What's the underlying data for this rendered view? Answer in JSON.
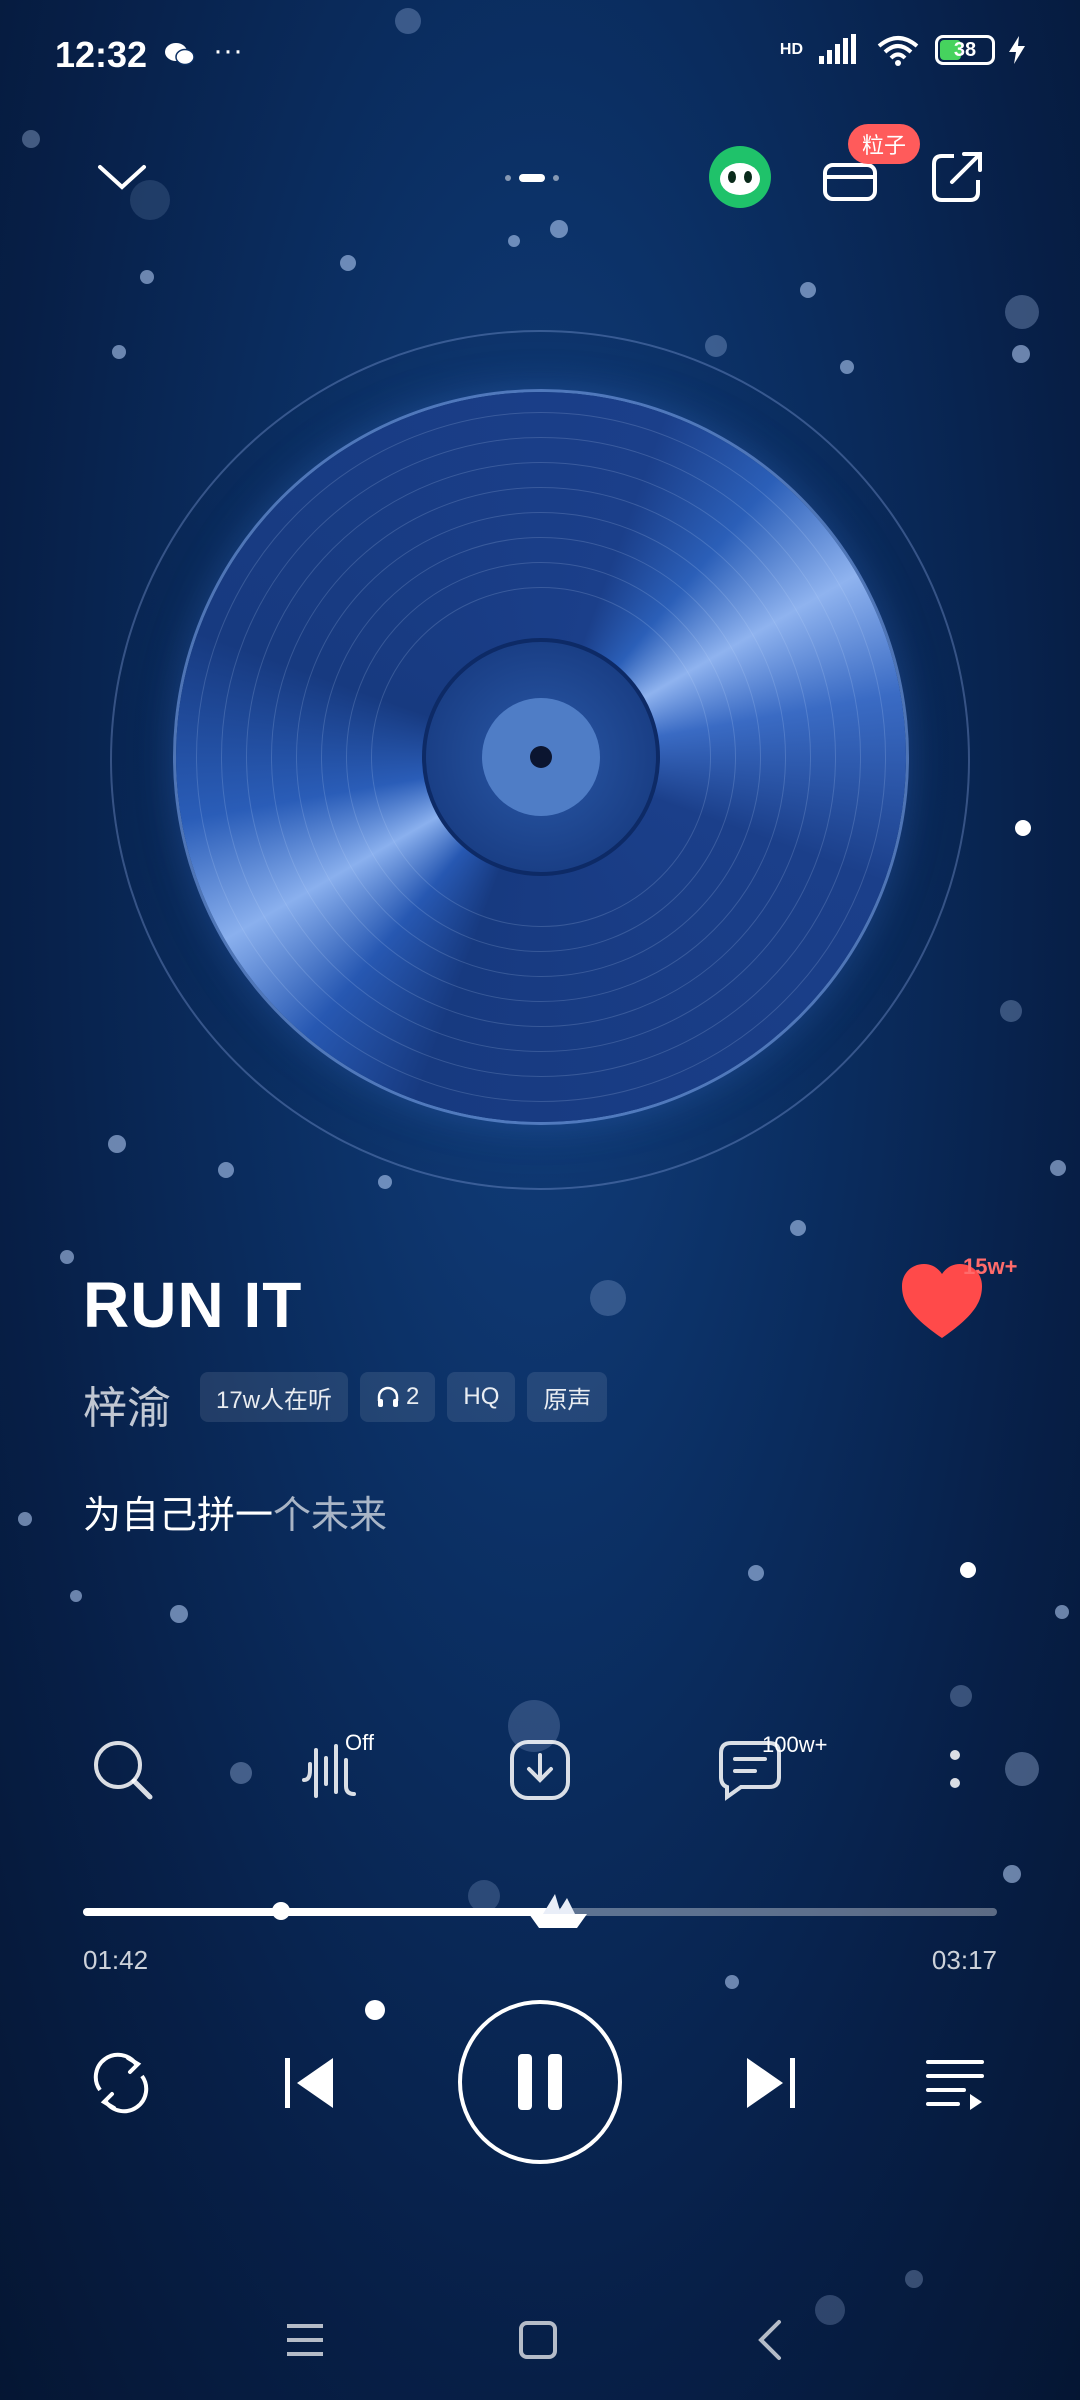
{
  "status": {
    "time": "12:32",
    "battery": "38",
    "network_label": "HD",
    "signal_sub": "6"
  },
  "header": {
    "badge": "粒子"
  },
  "song": {
    "title": "RUN IT",
    "artist": "梓渝",
    "tags": [
      "17w人在听",
      "2",
      "HQ",
      "原声"
    ],
    "lyric_bright": "为自己拼一",
    "lyric_dim": "个未来",
    "like_count": "15w+"
  },
  "actions": {
    "effect_state": "Off",
    "comment_count": "100w+"
  },
  "progress": {
    "elapsed": "01:42",
    "total": "03:17",
    "fraction": 0.52
  },
  "colors": {
    "accent_like": "#ff4a4a",
    "badge": "#ff5b5b",
    "battery": "#46d35e"
  }
}
